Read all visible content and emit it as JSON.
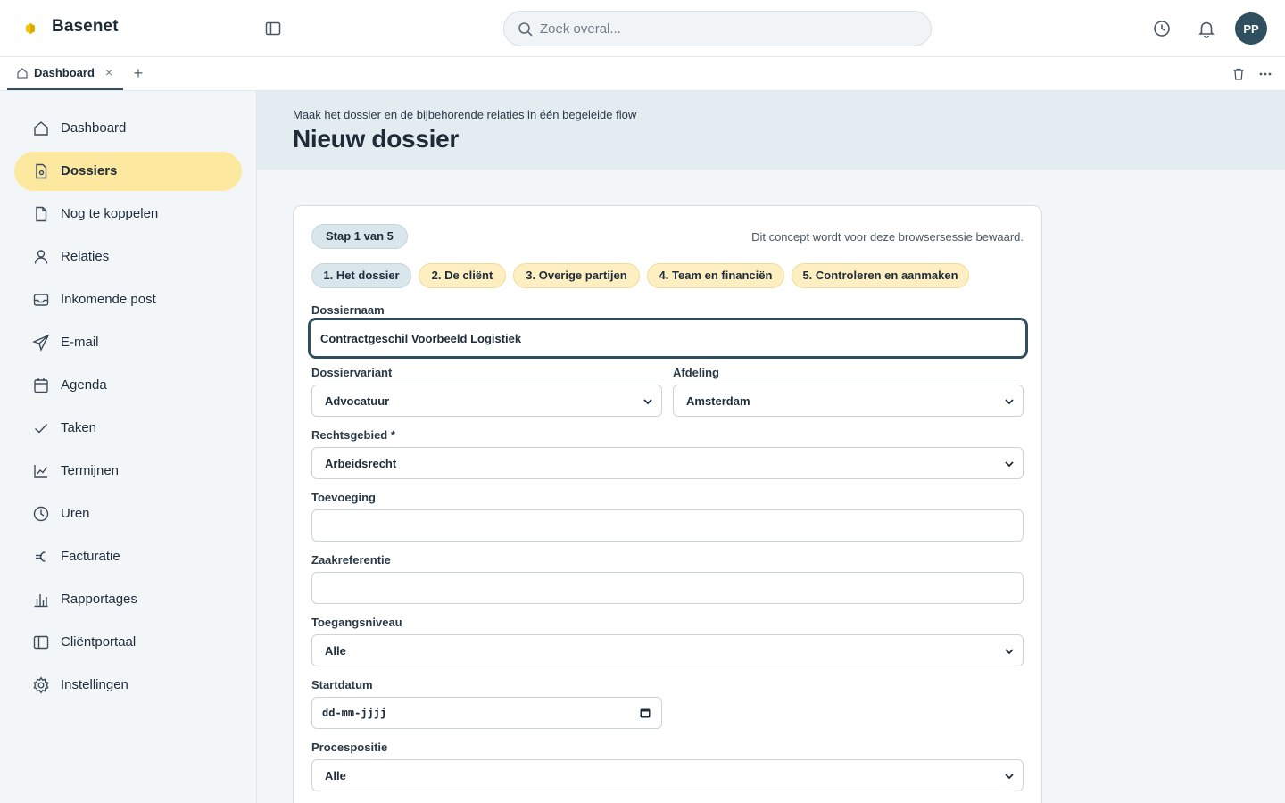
{
  "app": {
    "name": "Basenet"
  },
  "search": {
    "placeholder": "Zoek overal..."
  },
  "user": {
    "initials": "PP"
  },
  "tabs": [
    {
      "label": "Dashboard",
      "close": "×"
    }
  ],
  "tab_add": "+",
  "sidebar": {
    "items": [
      {
        "label": "Dashboard",
        "icon": "home-icon"
      },
      {
        "label": "Dossiers",
        "icon": "file-icon",
        "active": true
      },
      {
        "label": "Nog te koppelen",
        "icon": "document-icon"
      },
      {
        "label": "Relaties",
        "icon": "user-icon"
      },
      {
        "label": "Inkomende post",
        "icon": "inbox-icon"
      },
      {
        "label": "E-mail",
        "icon": "send-icon"
      },
      {
        "label": "Agenda",
        "icon": "calendar-icon"
      },
      {
        "label": "Taken",
        "icon": "check-icon"
      },
      {
        "label": "Termijnen",
        "icon": "chart-line-icon"
      },
      {
        "label": "Uren",
        "icon": "clock-icon"
      },
      {
        "label": "Facturatie",
        "icon": "euro-icon"
      },
      {
        "label": "Rapportages",
        "icon": "bar-chart-icon"
      },
      {
        "label": "Cliëntportaal",
        "icon": "panel-icon"
      },
      {
        "label": "Instellingen",
        "icon": "gear-icon"
      }
    ]
  },
  "page": {
    "subtitle": "Maak het dossier en de bijbehorende relaties in één begeleide flow",
    "title": "Nieuw dossier"
  },
  "wizard": {
    "step_indicator": "Stap 1 van 5",
    "concept_note": "Dit concept wordt voor deze browsersessie bewaard.",
    "steps": [
      "1. Het dossier",
      "2. De cliënt",
      "3. Overige partijen",
      "4. Team en financiën",
      "5. Controleren en aanmaken"
    ],
    "current_step": 1
  },
  "form": {
    "dossiernaam": {
      "label": "Dossiernaam",
      "value": "Contractgeschil Voorbeeld Logistiek"
    },
    "dossiervariant": {
      "label": "Dossiervariant",
      "value": "Advocatuur"
    },
    "afdeling": {
      "label": "Afdeling",
      "value": "Amsterdam"
    },
    "rechtsgebied": {
      "label": "Rechtsgebied *",
      "value": "Arbeidsrecht"
    },
    "toevoeging": {
      "label": "Toevoeging",
      "value": ""
    },
    "zaakreferentie": {
      "label": "Zaakreferentie",
      "value": ""
    },
    "toegangsniveau": {
      "label": "Toegangsniveau",
      "value": "Alle"
    },
    "startdatum": {
      "label": "Startdatum",
      "placeholder": "dd-mm-jjjj"
    },
    "procespositie": {
      "label": "Procespositie",
      "value": "Alle"
    }
  },
  "colors": {
    "accent": "#2f4f5f",
    "active_nav": "#fde8a0",
    "step_todo": "#fdefc2",
    "step_current": "#d9e6ec",
    "hero_bg": "#e2ecf1",
    "logo": "#f5c400"
  }
}
